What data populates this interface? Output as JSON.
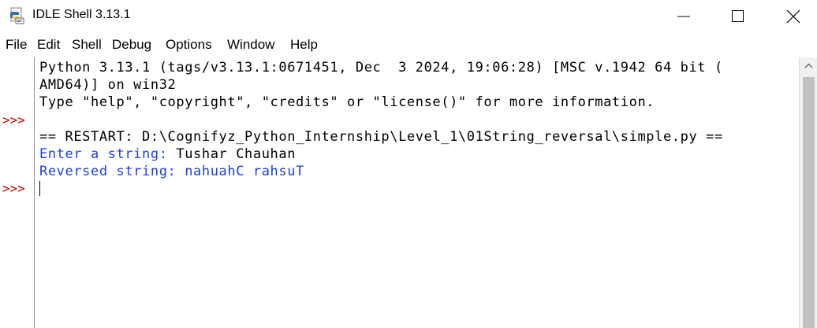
{
  "window": {
    "title": "IDLE Shell 3.13.1"
  },
  "menu": [
    "File",
    "Edit",
    "Shell",
    "Debug",
    "Options",
    "Window",
    "Help"
  ],
  "gutter": {
    "prompts": [
      ">>>",
      ">>>"
    ]
  },
  "shell": {
    "lines": [
      {
        "text": "Python 3.13.1 (tags/v3.13.1:0671451, Dec  3 2024, 19:06:28) [MSC v.1942 64 bit (",
        "color": "black"
      },
      {
        "text": "AMD64)] on win32",
        "color": "black"
      },
      {
        "text": "Type \"help\", \"copyright\", \"credits\" or \"license()\" for more information.",
        "color": "black"
      },
      {
        "text": "== RESTART: D:\\Cognifyz_Python_Internship\\Level_1\\01String_reversal\\simple.py ==",
        "color": "black"
      },
      {
        "text": "Enter a string: ",
        "color": "blue"
      },
      {
        "text": "Tushar Chauhan",
        "color": "black"
      },
      {
        "text": "Reversed string: nahuahC rahsuT",
        "color": "blue"
      }
    ]
  },
  "colors": {
    "prompt": "#c00000",
    "stdout": "#1f3fd6",
    "text": "#000000"
  }
}
